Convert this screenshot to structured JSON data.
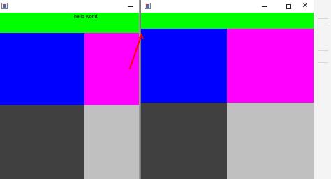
{
  "left_window": {
    "content_label": "hello world"
  },
  "right_window": {
    "content_label": ""
  },
  "colors": {
    "top_bar": "#00ff00",
    "top_left": "#0000ff",
    "top_right": "#ff00ff",
    "bottom_left": "#404040",
    "bottom_right": "#c0c0c0",
    "arrow": "#ff0000"
  },
  "icons": {
    "app": "java-app-icon",
    "minimize": "minimize-icon",
    "maximize": "maximize-icon",
    "close": "close-icon"
  },
  "glyphs": {
    "close": "✕"
  }
}
